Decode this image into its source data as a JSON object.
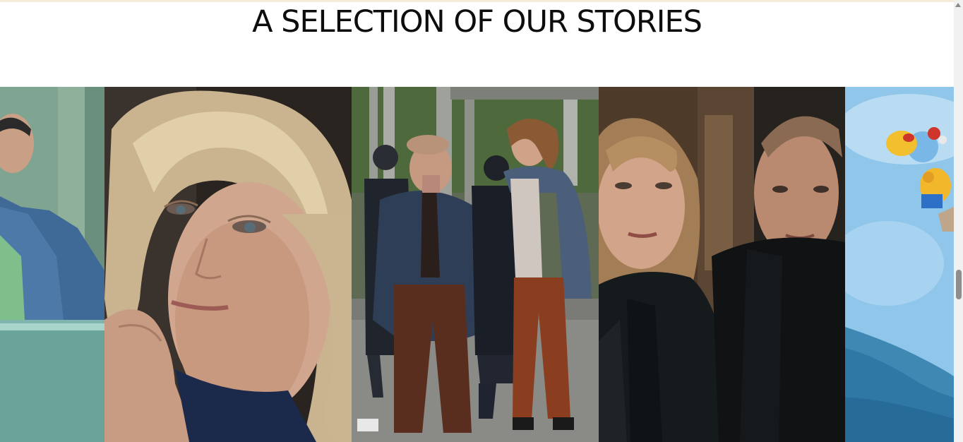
{
  "section": {
    "title": "A SELECTION OF OUR STORIES"
  },
  "stories": [
    {
      "icon": "young-man-denim-jacket-laptop-image"
    },
    {
      "icon": "blonde-woman-closeup-image"
    },
    {
      "icon": "police-scene-image"
    },
    {
      "icon": "woman-and-man-dark-scene-image"
    },
    {
      "icon": "animated-characters-sky-image"
    }
  ],
  "colors": {
    "title": "#0d0d0d",
    "background": "#ffffff",
    "top_border": "#f6ecd9"
  }
}
